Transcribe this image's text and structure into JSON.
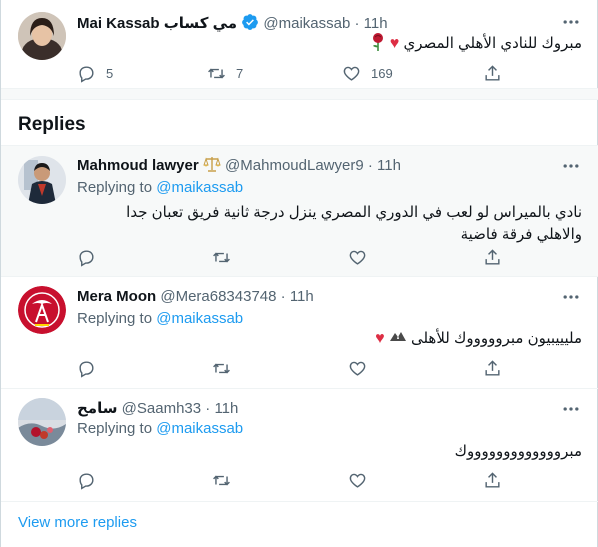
{
  "main_tweet": {
    "display_name": "Mai Kassab",
    "display_name_ar": "مي كساب",
    "handle": "@maikassab",
    "time": "11h",
    "text": "مبروك للنادي الأهلي المصري",
    "replies": "5",
    "retweets": "7",
    "likes": "169"
  },
  "replies_heading": "Replies",
  "replies": [
    {
      "display_name": "Mahmoud lawyer",
      "handle": "@MahmoudLawyer9",
      "time": "11h",
      "replying_prefix": "Replying to",
      "replying_to": "@maikassab",
      "text": "نادي بالميراس لو لعب في الدوري المصري ينزل درجة ثانية فريق تعبان جدا والاهلي فرقة فاضية"
    },
    {
      "display_name": "Mera Moon",
      "handle": "@Mera68343748",
      "time": "11h",
      "replying_prefix": "Replying to",
      "replying_to": "@maikassab",
      "text": "مليييبيون مبروووووك للأهلى"
    },
    {
      "display_name": "سامح",
      "handle": "@Saamh33",
      "time": "11h",
      "replying_prefix": "Replying to",
      "replying_to": "@maikassab",
      "text": "مبروووووووووووووك"
    }
  ],
  "view_more": "View more replies",
  "separators": [
    " · "
  ],
  "colors": {
    "accent": "#1d9bf0",
    "secondary_text": "#536471",
    "heart": "#e0245e",
    "verified": "#1d9bf0",
    "alahly_red": "#c8102e"
  }
}
